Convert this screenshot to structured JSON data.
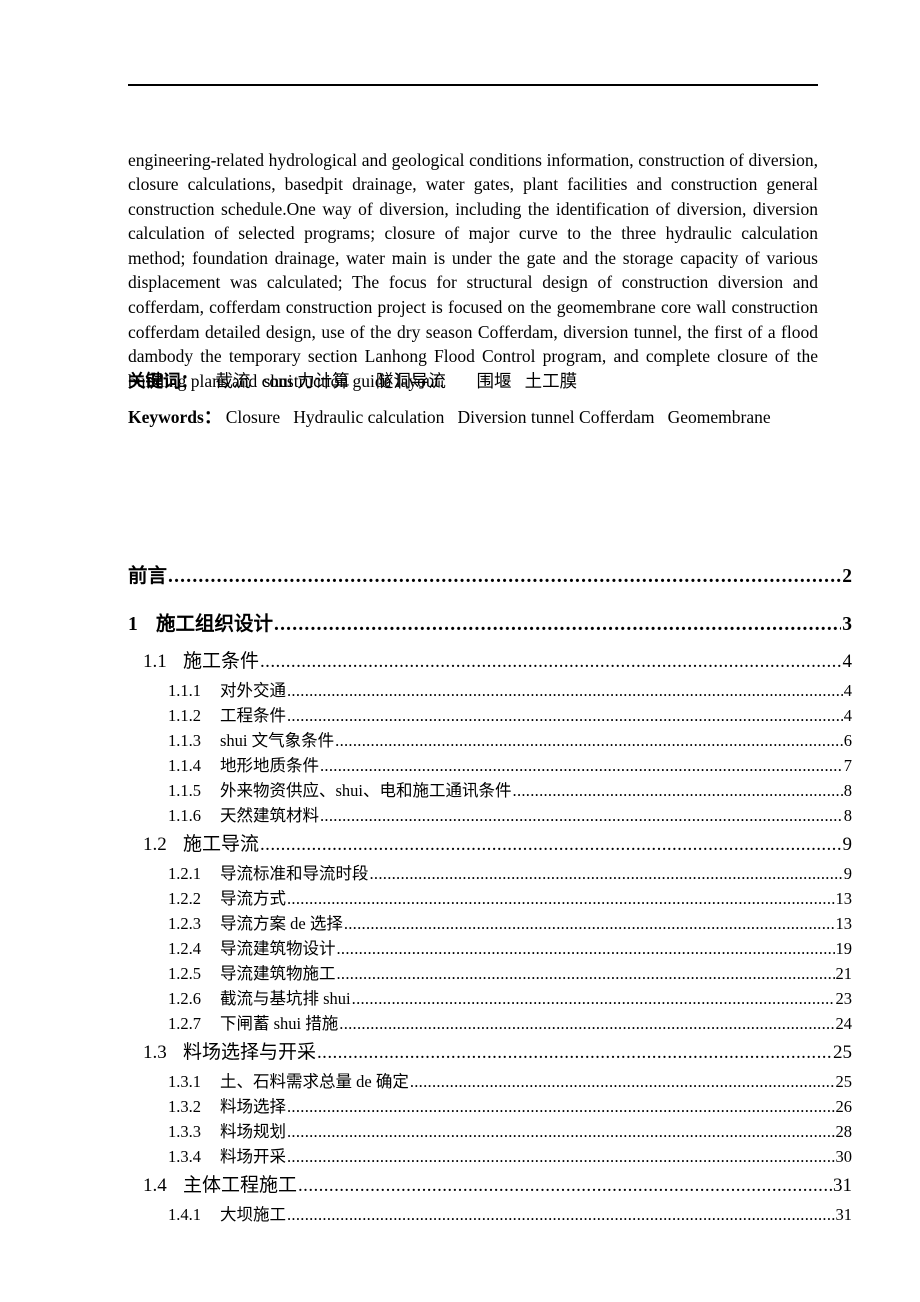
{
  "document": {
    "abstract_text": "engineering-related hydrological and geological conditions information, construction of diversion, closure calculations, basedpit drainage, water gates, plant facilities and construction general construction schedule.One way of diversion, including the identification of diversion, diversion calculation of selected programs; closure of major curve to the three hydraulic calculation method; foundation drainage, water main is under the gate and the storage capacity of various displacement was calculated; The focus for structural design of construction diversion and cofferdam, cofferdam construction project is focused on the geomembrane core wall construction cofferdam detailed design, use of the dry season Cofferdam, diversion tunnel, the first of a flood dambody the temporary section Lanhong Flood Control program, and complete closure of the building plans and construction guide layout."
  },
  "keywords_cn": {
    "label": "关键词：",
    "terms": "    截流   shui 力计算      隧洞导流       围堰   土工膜"
  },
  "keywords_en": {
    "label": "Keywords：",
    "terms": " Closure   Hydraulic calculation   Diversion tunnel Cofferdam   Geomembrane"
  },
  "toc": {
    "entries": [
      {
        "level": 1,
        "number": "",
        "title": "前言",
        "page": "2"
      },
      {
        "level": 1,
        "number": "1",
        "title": "施工组织设计",
        "page": "3"
      },
      {
        "level": 2,
        "number": "1.1",
        "title": "施工条件",
        "page": "4"
      },
      {
        "level": 3,
        "number": "1.1.1",
        "title": "对外交通",
        "page": "4"
      },
      {
        "level": 3,
        "number": "1.1.2",
        "title": "工程条件",
        "page": "4"
      },
      {
        "level": 3,
        "number": "1.1.3",
        "title": "shui 文气象条件",
        "page": "6"
      },
      {
        "level": 3,
        "number": "1.1.4",
        "title": "地形地质条件",
        "page": "7"
      },
      {
        "level": 3,
        "number": "1.1.5",
        "title": "外来物资供应、shui、电和施工通讯条件",
        "page": "8"
      },
      {
        "level": 3,
        "number": "1.1.6",
        "title": "天然建筑材料",
        "page": "8"
      },
      {
        "level": 2,
        "number": "1.2",
        "title": "施工导流",
        "page": "9"
      },
      {
        "level": 3,
        "number": "1.2.1",
        "title": "导流标准和导流时段",
        "page": "9"
      },
      {
        "level": 3,
        "number": "1.2.2",
        "title": "导流方式",
        "page": "13"
      },
      {
        "level": 3,
        "number": "1.2.3",
        "title": "导流方案 de 选择",
        "page": "13"
      },
      {
        "level": 3,
        "number": "1.2.4",
        "title": "导流建筑物设计",
        "page": "19"
      },
      {
        "level": 3,
        "number": "1.2.5",
        "title": "导流建筑物施工",
        "page": "21"
      },
      {
        "level": 3,
        "number": "1.2.6",
        "title": "截流与基坑排 shui",
        "page": "23"
      },
      {
        "level": 3,
        "number": "1.2.7",
        "title": "下闸蓄 shui 措施",
        "page": "24"
      },
      {
        "level": 2,
        "number": "1.3",
        "title": "料场选择与开采",
        "page": "25"
      },
      {
        "level": 3,
        "number": "1.3.1",
        "title": "土、石料需求总量 de 确定",
        "page": "25"
      },
      {
        "level": 3,
        "number": "1.3.2",
        "title": "料场选择",
        "page": "26"
      },
      {
        "level": 3,
        "number": "1.3.3",
        "title": "料场规划",
        "page": "28"
      },
      {
        "level": 3,
        "number": "1.3.4",
        "title": "料场开采",
        "page": "30"
      },
      {
        "level": 2,
        "number": "1.4",
        "title": "主体工程施工",
        "page": "31"
      },
      {
        "level": 3,
        "number": "1.4.1",
        "title": "大坝施工",
        "page": "31"
      }
    ]
  }
}
